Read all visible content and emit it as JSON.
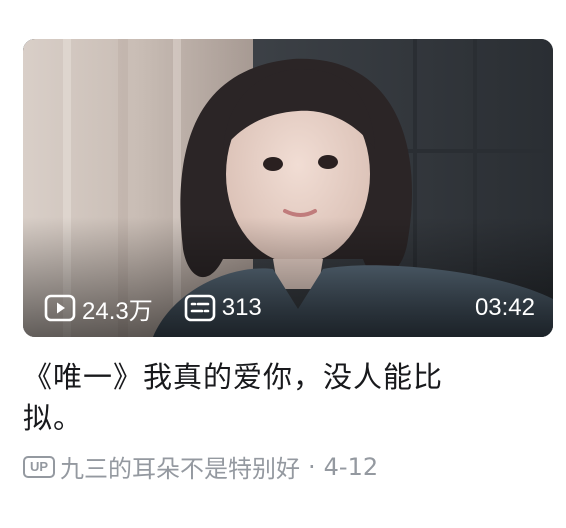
{
  "video": {
    "views": "24.3万",
    "comments": "313",
    "duration": "03:42",
    "title": "《唯一》我真的爱你，没人能比拟。",
    "up_badge": "UP",
    "uploader": "九三的耳朵不是特别好",
    "separator": "·",
    "date": "4-12"
  },
  "icons": {
    "views": "play-icon",
    "comments": "danmaku-icon"
  },
  "colors": {
    "title": "#18191c",
    "meta": "#9499a0",
    "overlay_text": "#ffffff"
  }
}
